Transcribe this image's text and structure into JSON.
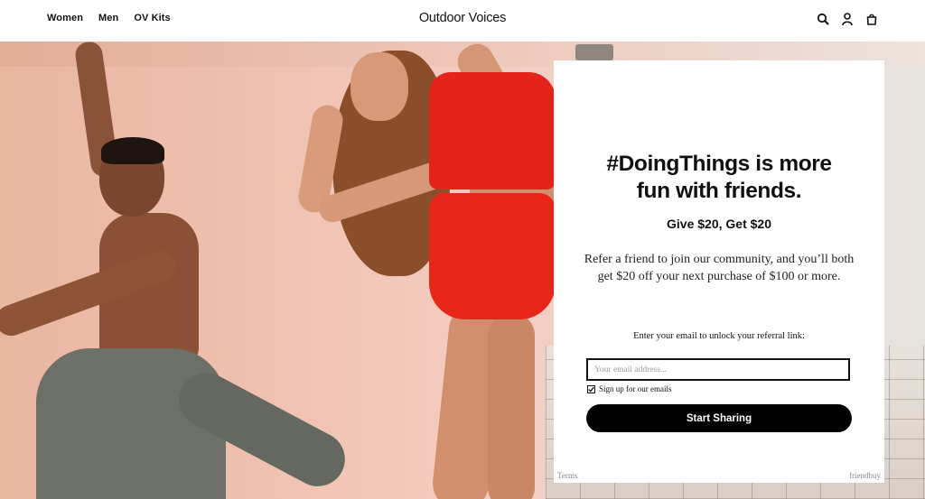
{
  "header": {
    "nav": [
      {
        "label": "Women"
      },
      {
        "label": "Men"
      },
      {
        "label": "OV Kits"
      }
    ],
    "brand": "Outdoor Voices",
    "icons": [
      "search-icon",
      "account-icon",
      "cart-icon"
    ]
  },
  "modal": {
    "headline_line1": "#DoingThings is more",
    "headline_line2": "fun with friends.",
    "offer": "Give $20, Get $20",
    "description_line1": "Refer a friend to join our community, and you’ll both",
    "description_line2": "get $20 off your next purchase of $100 or more.",
    "email_prompt": "Enter your email to unlock your referral link:",
    "email_placeholder": "Your email address...",
    "email_value": "",
    "signup_checked": true,
    "signup_label": "Sign up for our emails",
    "cta_label": "Start Sharing",
    "terms_label": "Terms",
    "powered_by": "friendbuy"
  },
  "colors": {
    "accent": "#000000",
    "text": "#111111",
    "shorts_red": "#e82519"
  }
}
